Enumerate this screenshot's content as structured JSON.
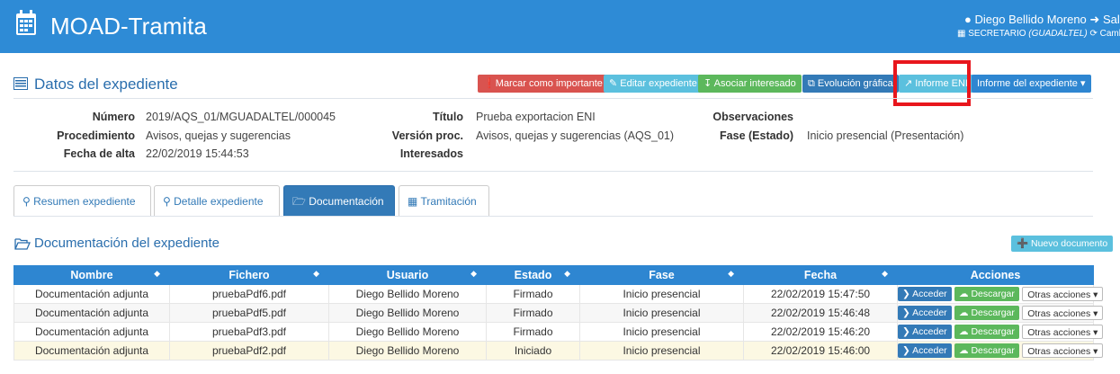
{
  "header": {
    "app_title": "MOAD-Tramita",
    "user_name": "Diego Bellido Moreno",
    "logout_label": "Sal",
    "role": "SECRETARIO",
    "org": "(GUADALTEL)",
    "change_label": "Cambia"
  },
  "expediente": {
    "section_title": "Datos del expediente",
    "buttons": {
      "important": "Marcar como importante",
      "edit": "Editar expediente",
      "associate": "Asociar interesado",
      "evolution": "Evolución gráfica",
      "eni": "Informe ENI",
      "report": "Informe del expediente"
    },
    "fields": {
      "numero_label": "Número",
      "numero_value": "2019/AQS_01/MGUADALTEL/000045",
      "procedimiento_label": "Procedimiento",
      "procedimiento_value": "Avisos, quejas y sugerencias",
      "fecha_label": "Fecha de alta",
      "fecha_value": "22/02/2019 15:44:53",
      "titulo_label": "Título",
      "titulo_value": "Prueba exportacion ENI",
      "version_label": "Versión proc.",
      "version_value": "Avisos, quejas y sugerencias (AQS_01)",
      "interesados_label": "Interesados",
      "observaciones_label": "Observaciones",
      "fase_label": "Fase (Estado)",
      "fase_value": "Inicio presencial (Presentación)"
    }
  },
  "tabs": {
    "resumen": "Resumen expediente",
    "detalle": "Detalle expediente",
    "documentacion": "Documentación",
    "tramitacion": "Tramitación"
  },
  "documents": {
    "title": "Documentación del expediente",
    "new_button": "Nuevo documento",
    "columns": {
      "nombre": "Nombre",
      "fichero": "Fichero",
      "usuario": "Usuario",
      "estado": "Estado",
      "fase": "Fase",
      "fecha": "Fecha",
      "acciones": "Acciones"
    },
    "action_labels": {
      "acceder": "Acceder",
      "descargar": "Descargar",
      "otras": "Otras acciones"
    },
    "rows": [
      {
        "nombre": "Documentación adjunta",
        "fichero": "pruebaPdf6.pdf",
        "usuario": "Diego Bellido Moreno",
        "estado": "Firmado",
        "fase": "Inicio presencial",
        "fecha": "22/02/2019 15:47:50"
      },
      {
        "nombre": "Documentación adjunta",
        "fichero": "pruebaPdf5.pdf",
        "usuario": "Diego Bellido Moreno",
        "estado": "Firmado",
        "fase": "Inicio presencial",
        "fecha": "22/02/2019 15:46:48"
      },
      {
        "nombre": "Documentación adjunta",
        "fichero": "pruebaPdf3.pdf",
        "usuario": "Diego Bellido Moreno",
        "estado": "Firmado",
        "fase": "Inicio presencial",
        "fecha": "22/02/2019 15:46:20"
      },
      {
        "nombre": "Documentación adjunta",
        "fichero": "pruebaPdf2.pdf",
        "usuario": "Diego Bellido Moreno",
        "estado": "Iniciado",
        "fase": "Inicio presencial",
        "fecha": "22/02/2019 15:46:00"
      }
    ]
  },
  "colors": {
    "primary": "#2e86d1",
    "highlight": "#e8161d"
  }
}
